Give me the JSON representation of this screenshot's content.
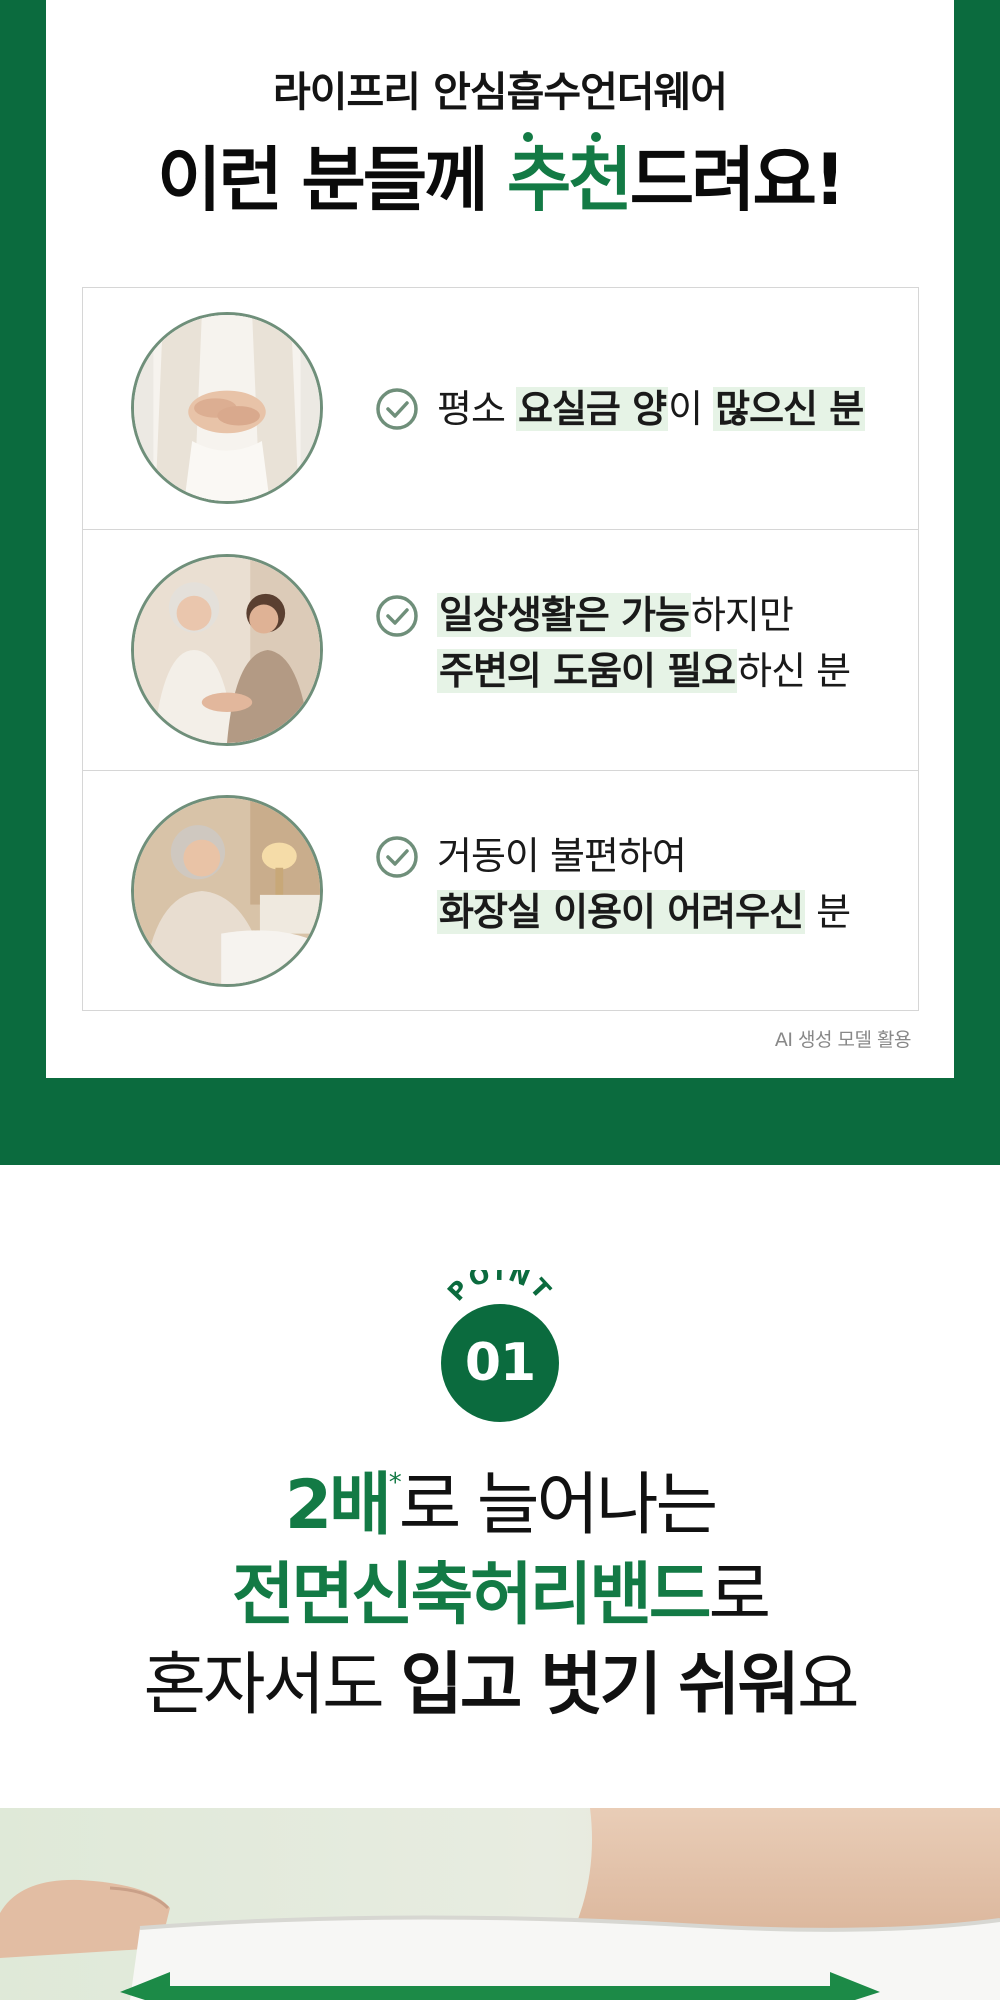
{
  "colors": {
    "brand_green": "#0b6b3e",
    "accent_green": "#137a45",
    "highlight": "#e6f3e6"
  },
  "recommend": {
    "eyebrow": "라이프리 안심흡수언더웨어",
    "title_prefix": "이런 분들께 ",
    "title_accent": "추천",
    "title_suffix": "드려요!",
    "items": [
      {
        "photo_icon": "woman-hands-on-abdomen-photo",
        "line1": [
          {
            "text": "평소 ",
            "strong": false
          },
          {
            "text": "요실금 양",
            "strong": true
          },
          {
            "text": "이 ",
            "strong": false
          },
          {
            "text": "많으신 분",
            "strong": true
          }
        ]
      },
      {
        "photo_icon": "senior-and-caregiver-photo",
        "line1": [
          {
            "text": "일상생활은 가능",
            "strong": true
          },
          {
            "text": "하지만",
            "strong": false
          }
        ],
        "line2": [
          {
            "text": "주변의 도움이 필요",
            "strong": true
          },
          {
            "text": "하신 분",
            "strong": false
          }
        ]
      },
      {
        "photo_icon": "senior-in-bed-photo",
        "line1": [
          {
            "text": "거동이 불편하여",
            "strong": false
          }
        ],
        "line2": [
          {
            "text": "화장실 이용이 어려우신",
            "strong": true
          },
          {
            "text": " 분",
            "strong": false
          }
        ]
      }
    ],
    "caption": "AI 생성 모델 활용"
  },
  "point": {
    "label": "POINT",
    "number": "01",
    "line1_accent": "2배",
    "line1_mark": "*",
    "line1_rest": "로 늘어나는",
    "line2_accent": "전면신축허리밴드",
    "line2_rest": "로",
    "line3_plain": "혼자서도 ",
    "line3_bold1": "입고 벗기",
    "line3_space": " ",
    "line3_bold2": "쉬워",
    "line3_rest": "요"
  },
  "product_image": {
    "icon": "waistband-stretch-photo"
  }
}
